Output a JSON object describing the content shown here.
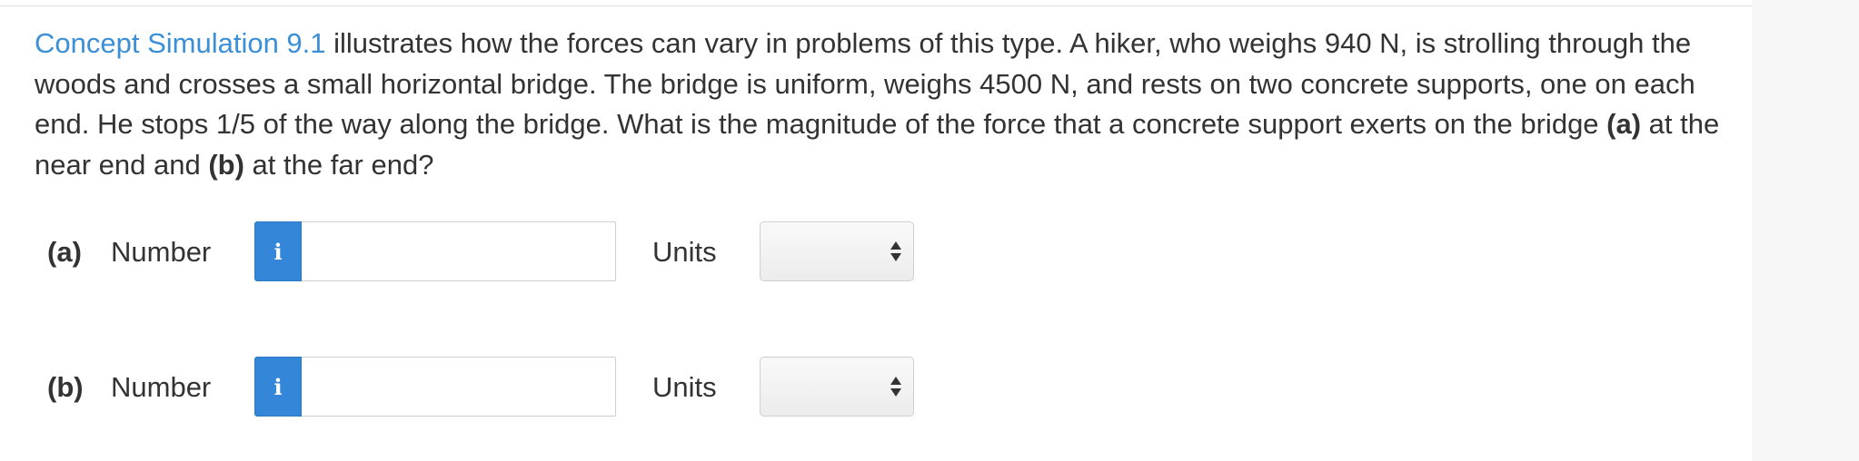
{
  "question": {
    "link_text": "Concept Simulation 9.1",
    "text_1": " illustrates how the forces can vary in problems of this type. A hiker, who weighs 940 N, is strolling through the woods and crosses a small horizontal bridge. The bridge is uniform, weighs 4500 N, and rests on two concrete supports, one on each end. He stops 1/5 of the way along the bridge. What is the magnitude of the force that a concrete support exerts on the bridge ",
    "part_a": "(a)",
    "text_2": " at the near end and ",
    "part_b": "(b)",
    "text_3": " at the far end?"
  },
  "answers": [
    {
      "part_label": "(a)",
      "number_label": "Number",
      "info_icon_glyph": "i",
      "number_value": "",
      "units_label": "Units",
      "units_selected": ""
    },
    {
      "part_label": "(b)",
      "number_label": "Number",
      "info_icon_glyph": "i",
      "number_value": "",
      "units_label": "Units",
      "units_selected": ""
    }
  ],
  "colors": {
    "link": "#3b8fd6",
    "info_button": "#3487d8",
    "text": "#333333"
  },
  "icons": {
    "info": "info-icon",
    "select_arrows": "up-down-arrows-icon"
  }
}
